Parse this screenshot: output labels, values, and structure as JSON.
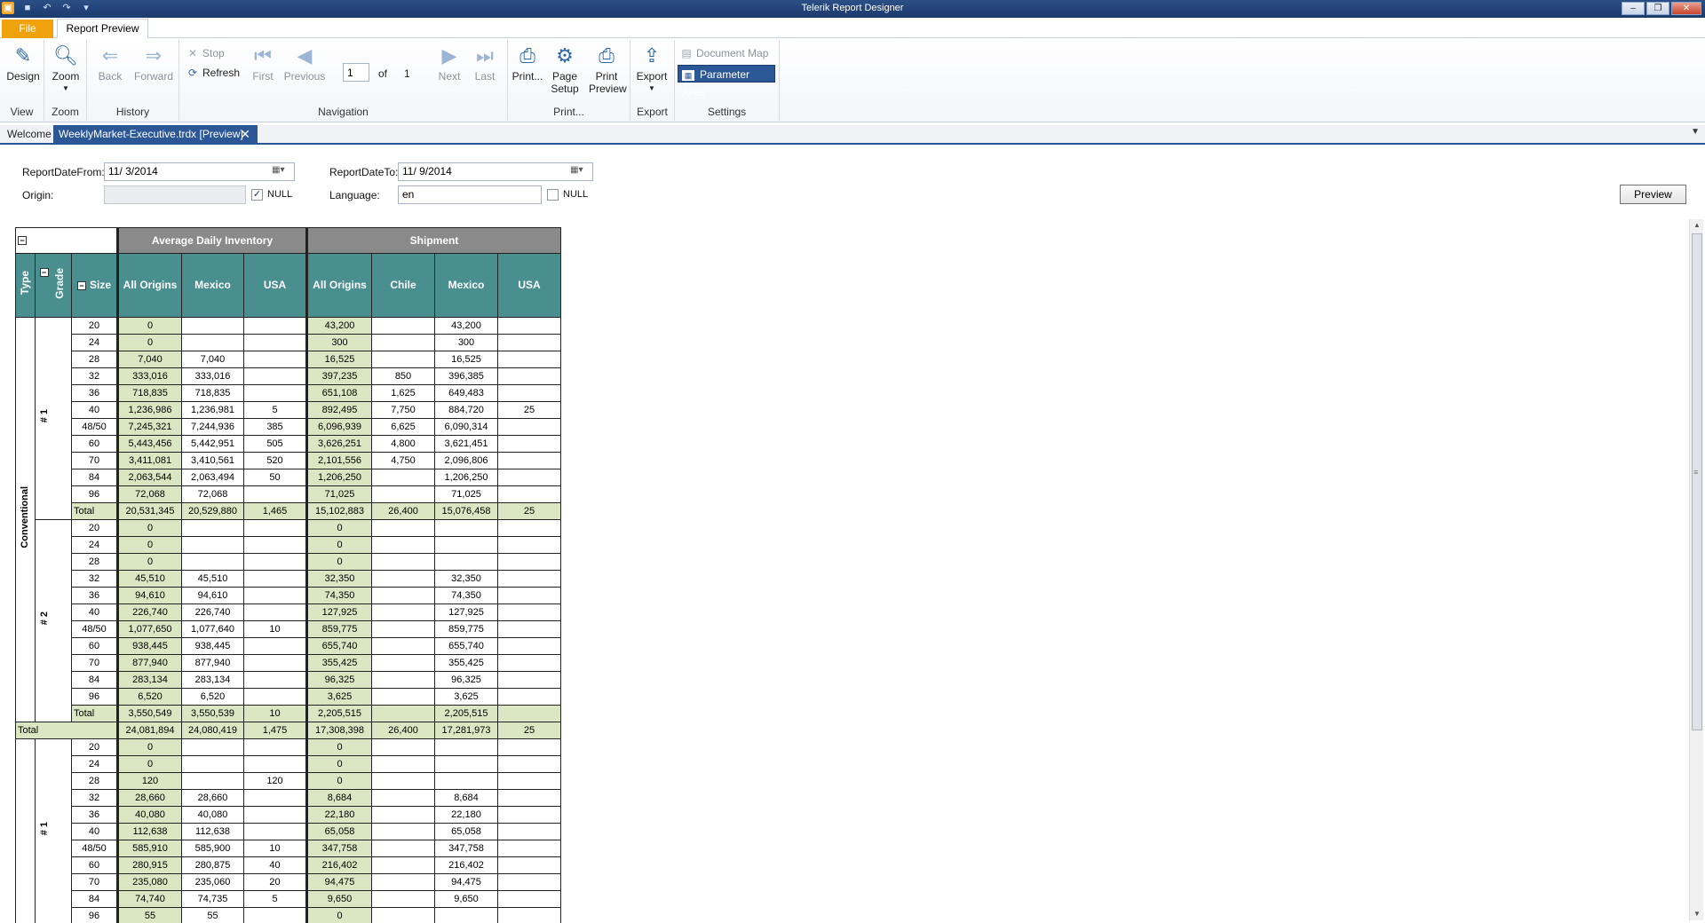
{
  "window": {
    "title": "Telerik Report Designer"
  },
  "ribbon_tabs": {
    "file": "File",
    "report_preview": "Report Preview"
  },
  "ribbon": {
    "design": "Design",
    "zoom": "Zoom",
    "back": "Back",
    "forward": "Forward",
    "stop": "Stop",
    "refresh": "Refresh",
    "first": "First",
    "previous": "Previous",
    "page_current": "1",
    "of": "of",
    "page_total": "1",
    "next": "Next",
    "last": "Last",
    "print": "Print...",
    "page_setup": "Page Setup",
    "print_preview": "Print Preview",
    "export": "Export",
    "document_map": "Document Map",
    "parameter_area": "Parameter Area",
    "groups": {
      "view": "View",
      "zoom": "Zoom",
      "history": "History",
      "navigation": "Navigation",
      "print": "Print...",
      "export": "Export",
      "settings": "Settings"
    }
  },
  "doc_tabs": {
    "welcome": "Welcome",
    "preview": "WeeklyMarket-Executive.trdx [Preview]"
  },
  "params": {
    "date_from_label": "ReportDateFrom:",
    "date_from_value": "11/ 3/2014",
    "date_to_label": "ReportDateTo:",
    "date_to_value": "11/ 9/2014",
    "origin_label": "Origin:",
    "origin_value": "",
    "origin_null_label": "NULL",
    "origin_null_checked": true,
    "language_label": "Language:",
    "language_value": "en",
    "language_null_label": "NULL",
    "language_null_checked": false,
    "preview_button": "Preview"
  },
  "report": {
    "toggle_origin": "Toggle Origin",
    "group_inventory": "Average Daily Inventory",
    "group_shipment": "Shipment",
    "col_type": "Type",
    "col_grade": "Grade",
    "col_size": "Size",
    "inventory_cols": [
      "All Origins",
      "Mexico",
      "USA"
    ],
    "shipment_cols": [
      "All Origins",
      "Chile",
      "Mexico",
      "USA"
    ],
    "type_label": "Conventional",
    "total_label": "Total",
    "grades": [
      {
        "grade": "# 1",
        "rows": [
          {
            "size": "20",
            "inv": [
              "0",
              "",
              ""
            ],
            "shp": [
              "43,200",
              "",
              "43,200",
              ""
            ]
          },
          {
            "size": "24",
            "inv": [
              "0",
              "",
              ""
            ],
            "shp": [
              "300",
              "",
              "300",
              ""
            ]
          },
          {
            "size": "28",
            "inv": [
              "7,040",
              "7,040",
              ""
            ],
            "shp": [
              "16,525",
              "",
              "16,525",
              ""
            ]
          },
          {
            "size": "32",
            "inv": [
              "333,016",
              "333,016",
              ""
            ],
            "shp": [
              "397,235",
              "850",
              "396,385",
              ""
            ]
          },
          {
            "size": "36",
            "inv": [
              "718,835",
              "718,835",
              ""
            ],
            "shp": [
              "651,108",
              "1,625",
              "649,483",
              ""
            ]
          },
          {
            "size": "40",
            "inv": [
              "1,236,986",
              "1,236,981",
              "5"
            ],
            "shp": [
              "892,495",
              "7,750",
              "884,720",
              "25"
            ]
          },
          {
            "size": "48/50",
            "inv": [
              "7,245,321",
              "7,244,936",
              "385"
            ],
            "shp": [
              "6,096,939",
              "6,625",
              "6,090,314",
              ""
            ]
          },
          {
            "size": "60",
            "inv": [
              "5,443,456",
              "5,442,951",
              "505"
            ],
            "shp": [
              "3,626,251",
              "4,800",
              "3,621,451",
              ""
            ]
          },
          {
            "size": "70",
            "inv": [
              "3,411,081",
              "3,410,561",
              "520"
            ],
            "shp": [
              "2,101,556",
              "4,750",
              "2,096,806",
              ""
            ]
          },
          {
            "size": "84",
            "inv": [
              "2,063,544",
              "2,063,494",
              "50"
            ],
            "shp": [
              "1,206,250",
              "",
              "1,206,250",
              ""
            ]
          },
          {
            "size": "96",
            "inv": [
              "72,068",
              "72,068",
              ""
            ],
            "shp": [
              "71,025",
              "",
              "71,025",
              ""
            ]
          }
        ],
        "total": {
          "inv": [
            "20,531,345",
            "20,529,880",
            "1,465"
          ],
          "shp": [
            "15,102,883",
            "26,400",
            "15,076,458",
            "25"
          ]
        }
      },
      {
        "grade": "# 2",
        "rows": [
          {
            "size": "20",
            "inv": [
              "0",
              "",
              ""
            ],
            "shp": [
              "0",
              "",
              "",
              ""
            ]
          },
          {
            "size": "24",
            "inv": [
              "0",
              "",
              ""
            ],
            "shp": [
              "0",
              "",
              "",
              ""
            ]
          },
          {
            "size": "28",
            "inv": [
              "0",
              "",
              ""
            ],
            "shp": [
              "0",
              "",
              "",
              ""
            ]
          },
          {
            "size": "32",
            "inv": [
              "45,510",
              "45,510",
              ""
            ],
            "shp": [
              "32,350",
              "",
              "32,350",
              ""
            ]
          },
          {
            "size": "36",
            "inv": [
              "94,610",
              "94,610",
              ""
            ],
            "shp": [
              "74,350",
              "",
              "74,350",
              ""
            ]
          },
          {
            "size": "40",
            "inv": [
              "226,740",
              "226,740",
              ""
            ],
            "shp": [
              "127,925",
              "",
              "127,925",
              ""
            ]
          },
          {
            "size": "48/50",
            "inv": [
              "1,077,650",
              "1,077,640",
              "10"
            ],
            "shp": [
              "859,775",
              "",
              "859,775",
              ""
            ]
          },
          {
            "size": "60",
            "inv": [
              "938,445",
              "938,445",
              ""
            ],
            "shp": [
              "655,740",
              "",
              "655,740",
              ""
            ]
          },
          {
            "size": "70",
            "inv": [
              "877,940",
              "877,940",
              ""
            ],
            "shp": [
              "355,425",
              "",
              "355,425",
              ""
            ]
          },
          {
            "size": "84",
            "inv": [
              "283,134",
              "283,134",
              ""
            ],
            "shp": [
              "96,325",
              "",
              "96,325",
              ""
            ]
          },
          {
            "size": "96",
            "inv": [
              "6,520",
              "6,520",
              ""
            ],
            "shp": [
              "3,625",
              "",
              "3,625",
              ""
            ]
          }
        ],
        "total": {
          "inv": [
            "3,550,549",
            "3,550,539",
            "10"
          ],
          "shp": [
            "2,205,515",
            "",
            "2,205,515",
            ""
          ]
        }
      }
    ],
    "type_total": {
      "inv": [
        "24,081,894",
        "24,080,419",
        "1,475"
      ],
      "shp": [
        "17,308,398",
        "26,400",
        "17,281,973",
        "25"
      ]
    },
    "second_type": {
      "grade": "# 1",
      "rows": [
        {
          "size": "20",
          "inv": [
            "0",
            "",
            ""
          ],
          "shp": [
            "0",
            "",
            "",
            ""
          ]
        },
        {
          "size": "24",
          "inv": [
            "0",
            "",
            ""
          ],
          "shp": [
            "0",
            "",
            "",
            ""
          ]
        },
        {
          "size": "28",
          "inv": [
            "120",
            "",
            "120"
          ],
          "shp": [
            "0",
            "",
            "",
            ""
          ]
        },
        {
          "size": "32",
          "inv": [
            "28,660",
            "28,660",
            ""
          ],
          "shp": [
            "8,684",
            "",
            "8,684",
            ""
          ]
        },
        {
          "size": "36",
          "inv": [
            "40,080",
            "40,080",
            ""
          ],
          "shp": [
            "22,180",
            "",
            "22,180",
            ""
          ]
        },
        {
          "size": "40",
          "inv": [
            "112,638",
            "112,638",
            ""
          ],
          "shp": [
            "65,058",
            "",
            "65,058",
            ""
          ]
        },
        {
          "size": "48/50",
          "inv": [
            "585,910",
            "585,900",
            "10"
          ],
          "shp": [
            "347,758",
            "",
            "347,758",
            ""
          ]
        },
        {
          "size": "60",
          "inv": [
            "280,915",
            "280,875",
            "40"
          ],
          "shp": [
            "216,402",
            "",
            "216,402",
            ""
          ]
        },
        {
          "size": "70",
          "inv": [
            "235,080",
            "235,060",
            "20"
          ],
          "shp": [
            "94,475",
            "",
            "94,475",
            ""
          ]
        },
        {
          "size": "84",
          "inv": [
            "74,740",
            "74,735",
            "5"
          ],
          "shp": [
            "9,650",
            "",
            "9,650",
            ""
          ]
        },
        {
          "size": "96",
          "inv": [
            "55",
            "55",
            ""
          ],
          "shp": [
            "0",
            "",
            "",
            ""
          ]
        }
      ]
    }
  }
}
